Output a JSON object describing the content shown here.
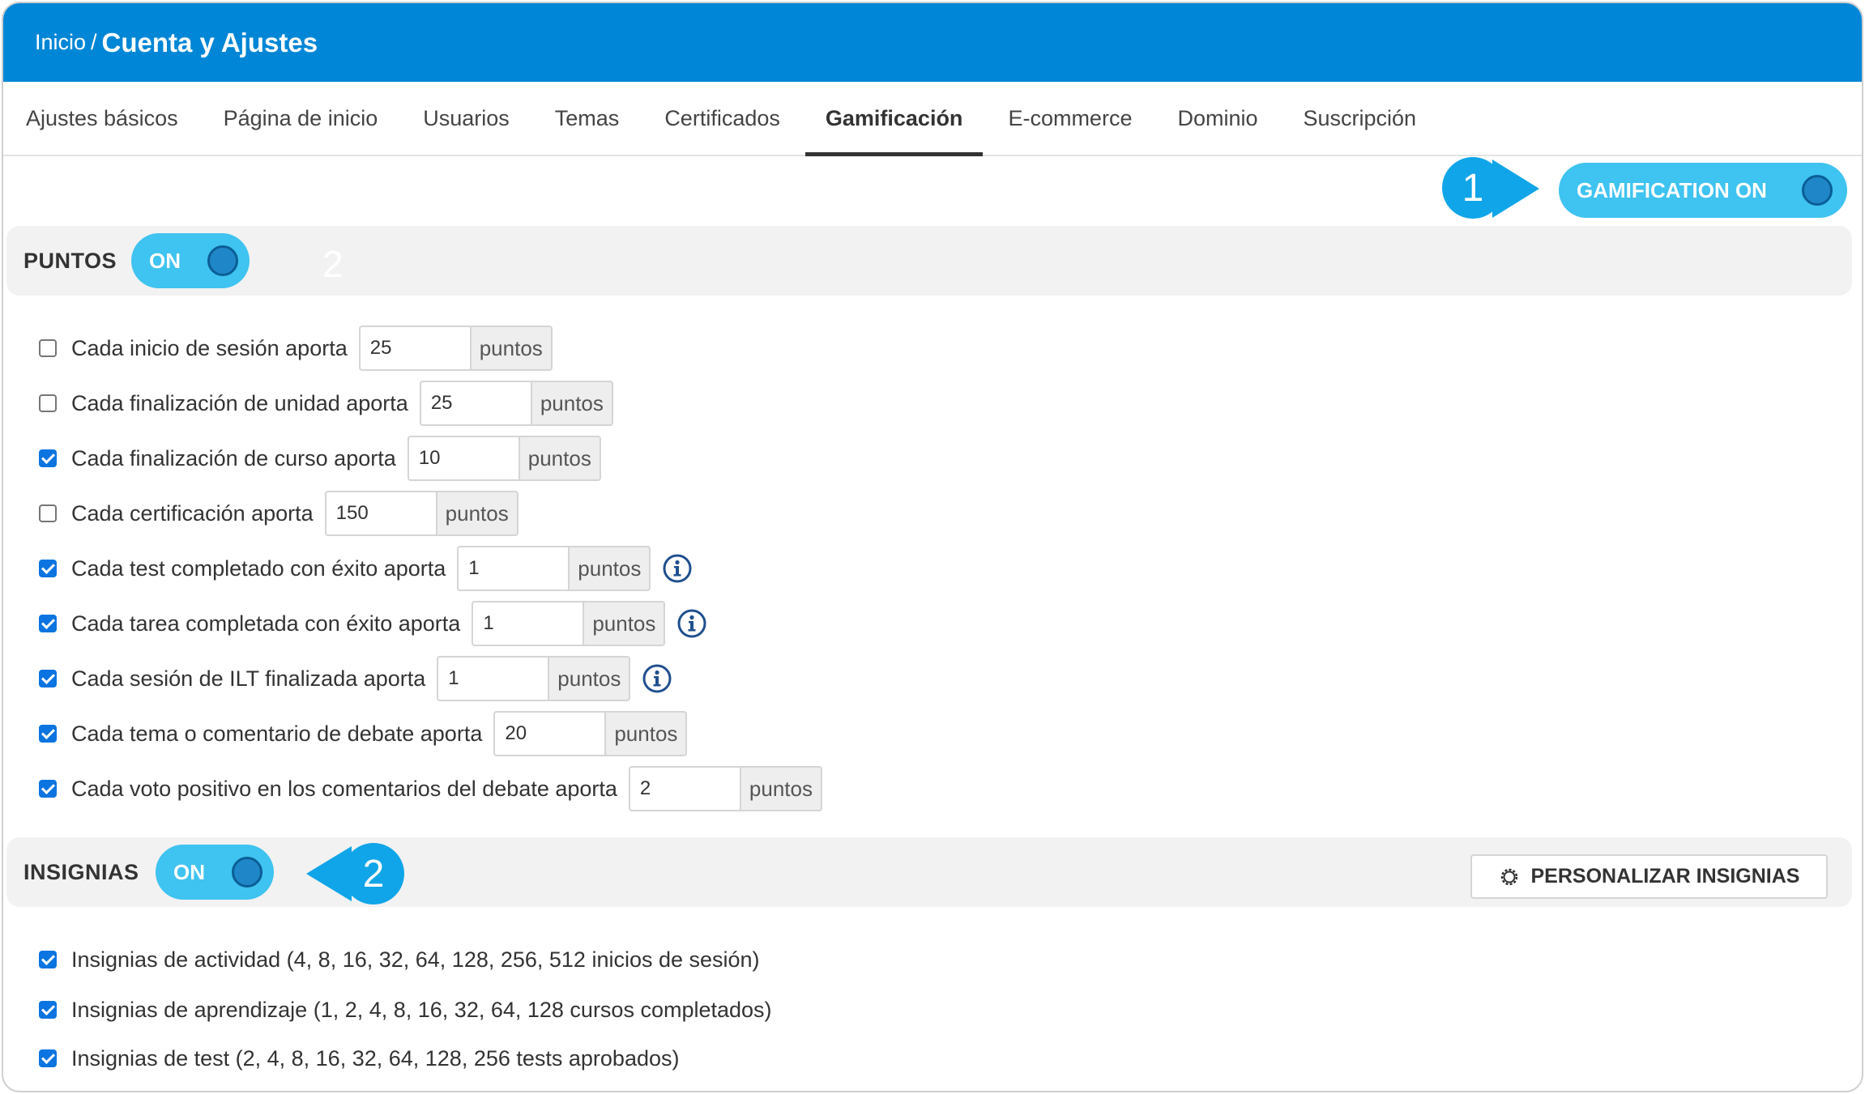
{
  "header": {
    "crumb": "Inicio",
    "separator": "/",
    "title": "Cuenta y Ajustes"
  },
  "tabs": [
    {
      "label": "Ajustes básicos"
    },
    {
      "label": "Página de inicio"
    },
    {
      "label": "Usuarios"
    },
    {
      "label": "Temas"
    },
    {
      "label": "Certificados"
    },
    {
      "label": "Gamificación",
      "active": true
    },
    {
      "label": "E-commerce"
    },
    {
      "label": "Dominio"
    },
    {
      "label": "Suscripción"
    }
  ],
  "gamification_toggle": {
    "label": "GAMIFICATION ON",
    "on": true
  },
  "callouts": {
    "one": "1",
    "two": "2",
    "ghost_two": "2"
  },
  "puntos": {
    "title": "PUNTOS",
    "toggle_label": "ON",
    "addon": "puntos",
    "rows": [
      {
        "label": "Cada inicio de sesión aporta",
        "value": "25",
        "checked": false,
        "info": false
      },
      {
        "label": "Cada finalización de unidad aporta",
        "value": "25",
        "checked": false,
        "info": false
      },
      {
        "label": "Cada finalización de curso aporta",
        "value": "10",
        "checked": true,
        "info": false
      },
      {
        "label": "Cada certificación aporta",
        "value": "150",
        "checked": false,
        "info": false
      },
      {
        "label": "Cada test completado con éxito aporta",
        "value": "1",
        "checked": true,
        "info": true
      },
      {
        "label": "Cada tarea completada con éxito aporta",
        "value": "1",
        "checked": true,
        "info": true
      },
      {
        "label": "Cada sesión de ILT finalizada aporta",
        "value": "1",
        "checked": true,
        "info": true
      },
      {
        "label": "Cada tema o comentario de debate aporta",
        "value": "20",
        "checked": true,
        "info": false
      },
      {
        "label": "Cada voto positivo en los comentarios del debate aporta",
        "value": "2",
        "checked": true,
        "info": false
      }
    ]
  },
  "insignias": {
    "title": "INSIGNIAS",
    "toggle_label": "ON",
    "customize_label": "PERSONALIZAR INSIGNIAS",
    "rows": [
      {
        "label": "Insignias de actividad (4, 8, 16, 32, 64, 128, 256, 512 inicios de sesión)",
        "checked": true
      },
      {
        "label": "Insignias de aprendizaje (1, 2, 4, 8, 16, 32, 64, 128 cursos completados)",
        "checked": true
      },
      {
        "label": "Insignias de test (2, 4, 8, 16, 32, 64, 128, 256 tests aprobados)",
        "checked": true
      }
    ]
  },
  "colors": {
    "header": "#0086d6",
    "toggle": "#3fc3f0",
    "callout": "#10a5e8",
    "checkbox": "#0b74e0",
    "info": "#1f4f8f"
  }
}
